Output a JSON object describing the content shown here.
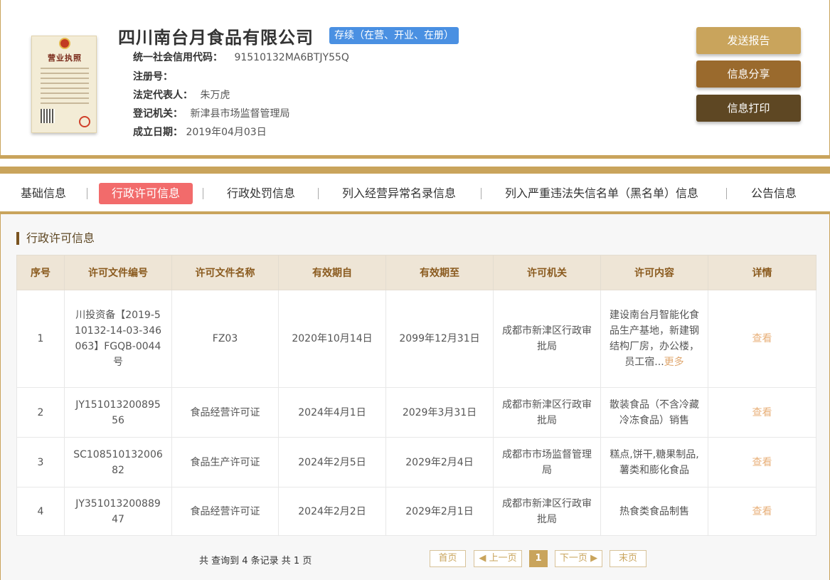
{
  "company": {
    "name": "四川南台月食品有限公司",
    "status": "存续（在营、开业、在册）",
    "license_image": {
      "title": "营业执照"
    },
    "fields": [
      {
        "label": "统一社会信用代码：",
        "value": "91510132MA6BTJY55Q"
      },
      {
        "label": "注册号：",
        "value": ""
      },
      {
        "label": "法定代表人：",
        "value": "朱万虎"
      },
      {
        "label": "登记机关：",
        "value": "新津县市场监督管理局"
      },
      {
        "label": "成立日期：",
        "value": "2019年04月03日"
      }
    ]
  },
  "actions": {
    "send_report": "发送报告",
    "share": "信息分享",
    "print": "信息打印"
  },
  "tabs": [
    {
      "label": "基础信息",
      "active": false
    },
    {
      "label": "行政许可信息",
      "active": true
    },
    {
      "label": "行政处罚信息",
      "active": false
    },
    {
      "label": "列入经营异常名录信息",
      "active": false
    },
    {
      "label": "列入严重违法失信名单（黑名单）信息",
      "active": false
    },
    {
      "label": "公告信息",
      "active": false
    }
  ],
  "section": {
    "title": "行政许可信息",
    "columns": [
      "序号",
      "许可文件编号",
      "许可文件名称",
      "有效期自",
      "有效期至",
      "许可机关",
      "许可内容",
      "详情"
    ],
    "rows": [
      {
        "no": "1",
        "doc_no": "川投资备【2019-510132-14-03-346063】FGQB-0044号",
        "doc_name": "FZ03",
        "from": "2020年10月14日",
        "to": "2099年12月31日",
        "authority": "成都市新津区行政审批局",
        "content": "建设南台月智能化食品生产基地，新建钢结构厂房，办公楼，员工宿...",
        "more": "更多",
        "detail": "查看"
      },
      {
        "no": "2",
        "doc_no": "JY15101320089556",
        "doc_name": "食品经营许可证",
        "from": "2024年4月1日",
        "to": "2029年3月31日",
        "authority": "成都市新津区行政审批局",
        "content": "散装食品（不含冷藏冷冻食品）销售",
        "more": "",
        "detail": "查看"
      },
      {
        "no": "3",
        "doc_no": "SC10851013200682",
        "doc_name": "食品生产许可证",
        "from": "2024年2月5日",
        "to": "2029年2月4日",
        "authority": "成都市市场监督管理局",
        "content": "糕点,饼干,糖果制品,薯类和膨化食品",
        "more": "",
        "detail": "查看"
      },
      {
        "no": "4",
        "doc_no": "JY35101320088947",
        "doc_name": "食品经营许可证",
        "from": "2024年2月2日",
        "to": "2029年2月1日",
        "authority": "成都市新津区行政审批局",
        "content": "热食类食品制售",
        "more": "",
        "detail": "查看"
      }
    ]
  },
  "pagination": {
    "summary": "共 查询到 4 条记录 共 1 页",
    "first": "首页",
    "prev": "上一页",
    "current": "1",
    "next": "下一页",
    "last": "末页"
  },
  "colors": {
    "gold": "#c9a45c",
    "brown": "#9a6a2d",
    "dark_brown": "#5e4723",
    "active_tab": "#f26b6b",
    "status_blue": "#4a90e2"
  }
}
